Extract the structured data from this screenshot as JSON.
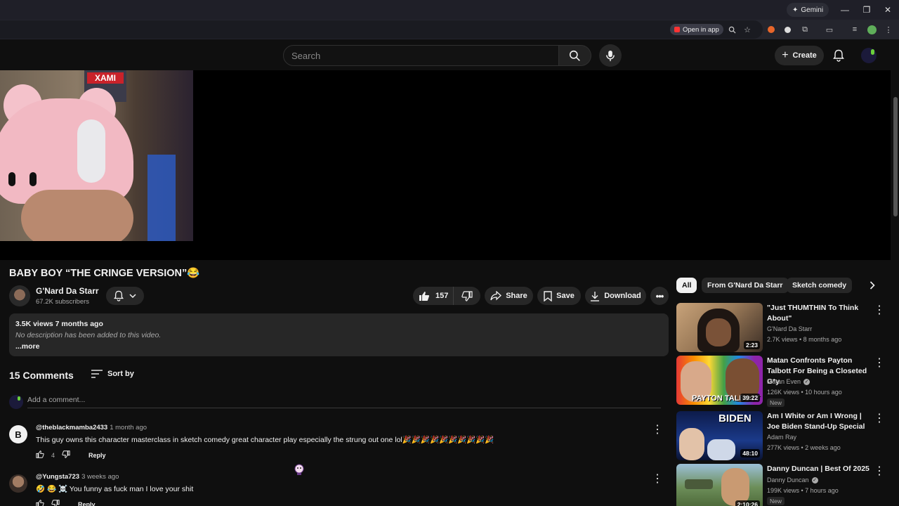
{
  "browser": {
    "gemini_label": "Gemini",
    "open_in_app_label": "Open in app"
  },
  "masthead": {
    "search_placeholder": "Search",
    "create_label": "Create"
  },
  "webcam": {
    "poster_text": "XAMI"
  },
  "video": {
    "title": "BABY BOY “THE CRINGE VERSION”😂",
    "channel_name": "G'Nard Da Starr",
    "subscribers": "67.2K subscribers",
    "likes": "157",
    "share_label": "Share",
    "save_label": "Save",
    "download_label": "Download"
  },
  "description": {
    "meta": "3.5K views  7 months ago",
    "text": "No description has been added to this video.",
    "more_label": "...more"
  },
  "comments": {
    "count_label": "15 Comments",
    "sort_label": "Sort by",
    "add_placeholder": "Add a comment...",
    "reply_label": "Reply",
    "items": [
      {
        "avatar_letter": "B",
        "author": "@theblackmamba2433",
        "time": "1 month ago",
        "text": "This guy owns this character masterclass in sketch comedy great character play especially the strung out one lol🎉🎉🎉🎉🎉🎉🎉🎉🎉🎉",
        "likes": "4"
      },
      {
        "avatar_letter": "",
        "author": "@Yungsta723",
        "time": "3 weeks ago",
        "text": "🤣 😂 ☠️ You funny as fuck man I love your shit",
        "likes": ""
      }
    ]
  },
  "chips": [
    "All",
    "From G'Nard Da Starr",
    "Sketch comedy"
  ],
  "recommendations": [
    {
      "title": "\"Just THUMTHIN To Think About\"",
      "channel": "G'Nard Da Starr",
      "verified": false,
      "stats": "2.7K views • 8 months ago",
      "duration": "2:23",
      "badge": ""
    },
    {
      "title": "Matan Confronts Payton Talbott For Being a Closeted G*y",
      "channel": "Matan Even",
      "verified": true,
      "stats": "126K views • 10 hours ago",
      "duration": "39:22",
      "badge": "New",
      "thumb_text": "PAYTON TALBOTT"
    },
    {
      "title": "Am I White or Am I Wrong | Joe Biden Stand-Up Special",
      "channel": "Adam Ray",
      "verified": false,
      "stats": "277K views • 2 weeks ago",
      "duration": "48:10",
      "badge": "",
      "thumb_text": "BIDEN"
    },
    {
      "title": "Danny Duncan | Best Of 2025",
      "channel": "Danny Duncan",
      "verified": true,
      "stats": "199K views • 7 hours ago",
      "duration": "2:10:26",
      "badge": "New"
    }
  ]
}
